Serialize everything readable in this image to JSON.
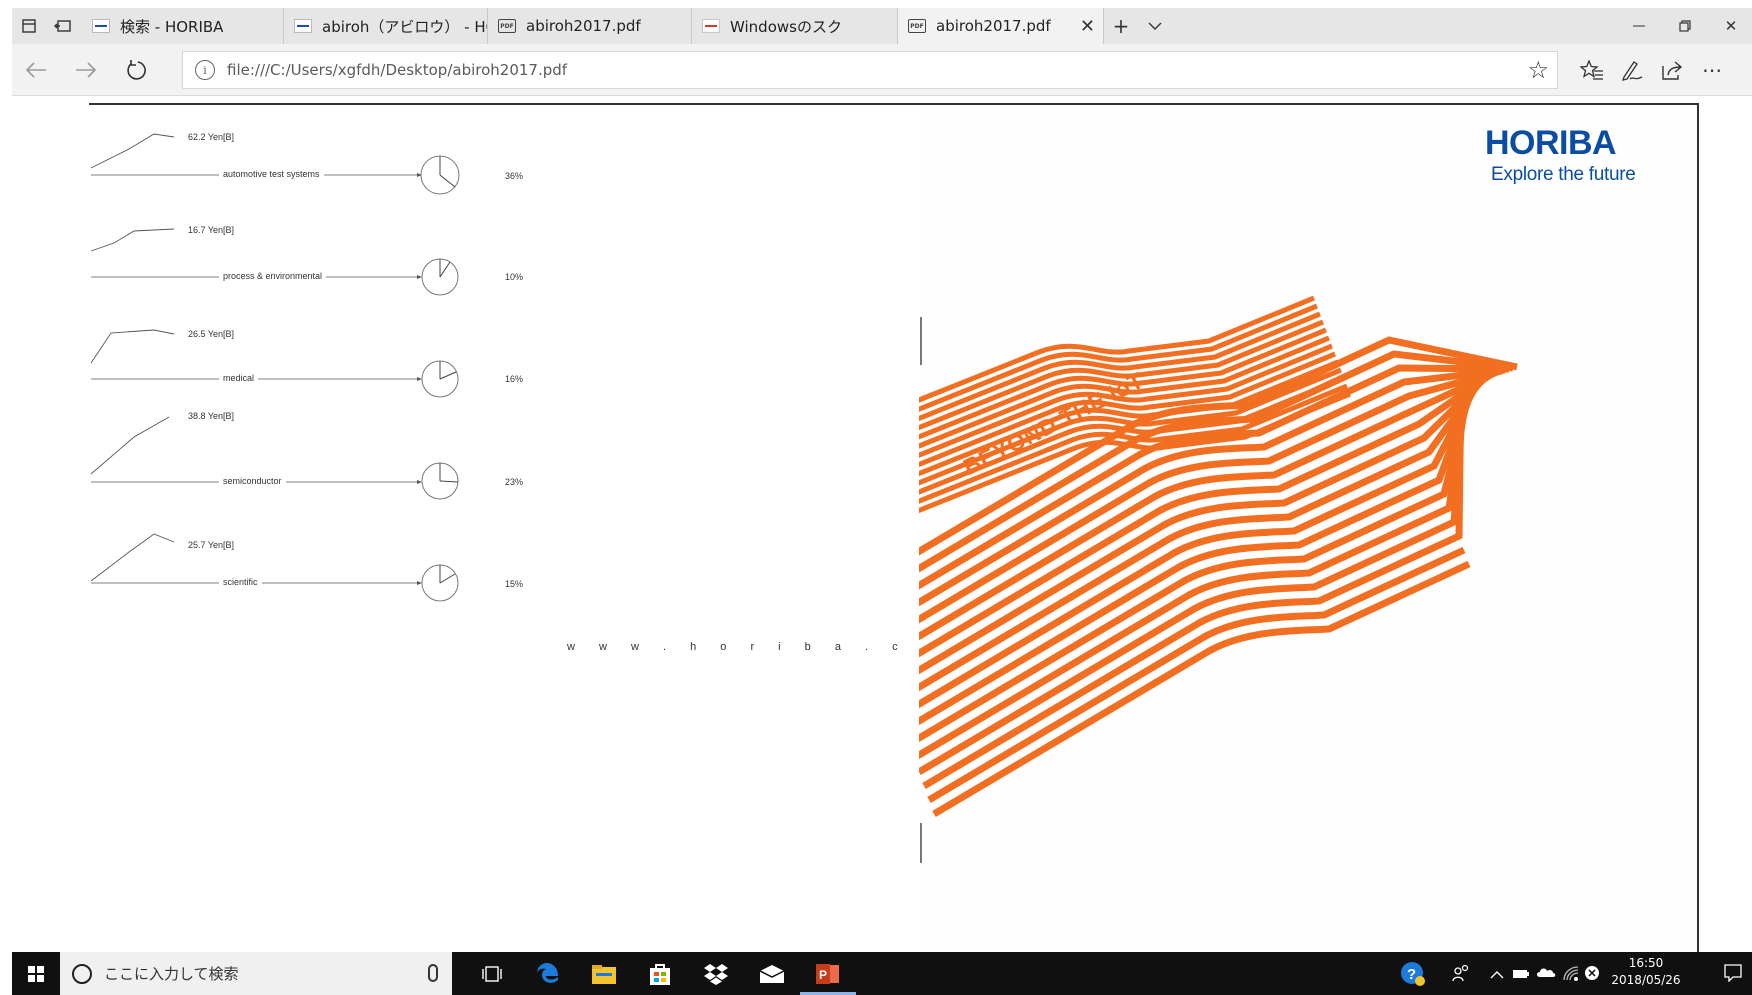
{
  "browser": {
    "tabs": [
      {
        "label": "検索 - HORIBA",
        "favicon": "horiba-favicon-icon",
        "active": false
      },
      {
        "label": "abiroh（アビロウ） - HORIBA",
        "favicon": "horiba-favicon-icon",
        "active": false
      },
      {
        "label": "abiroh2017.pdf",
        "favicon": "pdf-icon",
        "active": false
      },
      {
        "label": "Windowsのスク",
        "favicon": "horiba-favicon-icon",
        "active": false
      },
      {
        "label": "abiroh2017.pdf",
        "favicon": "pdf-icon",
        "active": true
      }
    ],
    "address": "file:///C:/Users/xgfdh/Desktop/abiroh2017.pdf",
    "icons": {
      "tab_preview": "tab-preview-icon",
      "set_aside": "set-tabs-aside-icon",
      "new_tab": "plus-icon",
      "tab_list": "chevron-down-icon",
      "minimize": "minimize-icon",
      "restore": "restore-icon",
      "close": "close-icon",
      "back": "back-arrow-icon",
      "forward": "forward-arrow-icon",
      "refresh": "refresh-icon",
      "favorite": "star-icon",
      "favorites_hub": "favorites-list-icon",
      "web_note": "pen-icon",
      "share": "share-icon",
      "more": "more-icon"
    }
  },
  "document": {
    "segments": [
      {
        "sales": "62.2 Yen[B]",
        "name": "automotive test systems",
        "share": "36%",
        "share_value": 36
      },
      {
        "sales": "16.7 Yen[B]",
        "name": "process & environmental",
        "share": "10%",
        "share_value": 10
      },
      {
        "sales": "26.5 Yen[B]",
        "name": "medical",
        "share": "16%",
        "share_value": 16
      },
      {
        "sales": "38.8 Yen[B]",
        "name": "semiconductor",
        "share": "23%",
        "share_value": 23
      },
      {
        "sales": "25.7 Yen[B]",
        "name": "scientific",
        "share": "15%",
        "share_value": 15
      }
    ],
    "website": "w w w . h o r i b a . c o . j p",
    "logo_text": "HORIBA",
    "tagline": "Explore the future",
    "cover_text": "BEYOND THE IoT",
    "colors": {
      "brand_blue": "#0b4da3",
      "accent_orange": "#f26f21"
    }
  },
  "taskbar": {
    "search_placeholder": "ここに入力して検索",
    "apps": [
      "task-view-icon",
      "edge-icon",
      "file-explorer-icon",
      "store-icon",
      "dropbox-icon",
      "mail-icon",
      "powerpoint-icon"
    ],
    "time": "16:50",
    "date": "2018/05/26"
  }
}
